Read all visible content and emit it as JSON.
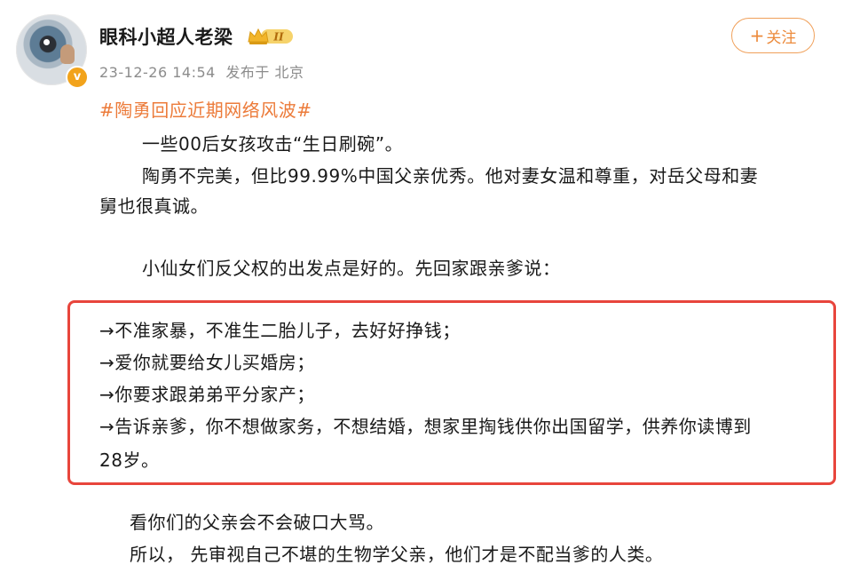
{
  "post": {
    "author": {
      "name": "眼科小超人老梁",
      "verified_icon": "verified-v-badge",
      "level_badge": "II"
    },
    "meta": {
      "time": "23-12-26 14:54",
      "location": "发布于 北京"
    },
    "follow_button": {
      "plus": "+",
      "label": "关注"
    },
    "hashtag": "#陶勇回应近期网络风波#",
    "paragraphs": [
      "一些00后女孩攻击“生日刷碗”。",
      "陶勇不完美，但比99.99%中国父亲优秀。他对妻女温和尊重，对岳父母和妻",
      "舅也很真诚。",
      "小仙女们反父权的出发点是好的。先回家跟亲爹说："
    ],
    "boxed_items": [
      "→不准家暴，不准生二胎儿子，去好好挣钱；",
      "→爱你就要给女儿买婚房；",
      "→你要求跟弟弟平分家产；",
      "→告诉亲爹，你不想做家务，不想结婚，想家里掏钱供你出国留学，供养你读博到",
      "28岁。"
    ],
    "closing": [
      "看你们的父亲会不会破口大骂。",
      "所以， 先审视自己不堪的生物学父亲，他们才是不配当爹的人类。"
    ]
  },
  "colors": {
    "accent": "#ec7b3a",
    "follow_border": "#f0a05a",
    "highlight_border": "#e8453c",
    "meta_gray": "#8c8c8c",
    "verified_orange": "#f2a31b"
  }
}
